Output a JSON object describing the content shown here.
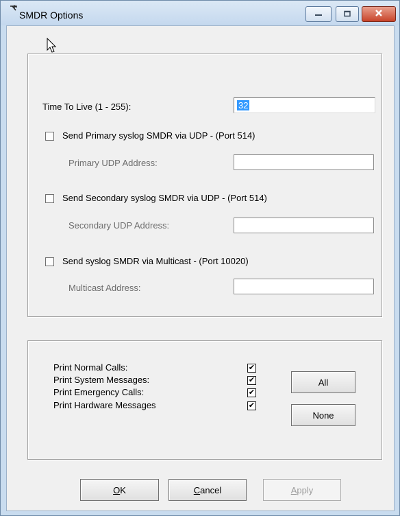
{
  "window": {
    "title": "SMDR Options",
    "icon": "smdr-app-icon",
    "controls": [
      "minimize-icon",
      "maximize-icon",
      "close-icon"
    ]
  },
  "syslog": {
    "ttl_label": "Time To Live (1 - 255):",
    "ttl_value": "32",
    "primary_checkbox": "Send Primary syslog SMDR via UDP - (Port 514)",
    "primary_address_label": "Primary UDP Address:",
    "primary_address_value": "",
    "secondary_checkbox": "Send Secondary syslog SMDR via UDP - (Port 514)",
    "secondary_address_label": "Secondary UDP Address:",
    "secondary_address_value": "",
    "multicast_checkbox": "Send syslog SMDR via Multicast - (Port 10020)",
    "multicast_address_label": "Multicast Address:",
    "multicast_address_value": ""
  },
  "print_options": {
    "items": [
      {
        "label": "Print Normal Calls:",
        "checked": true
      },
      {
        "label": "Print System Messages:",
        "checked": true
      },
      {
        "label": "Print Emergency Calls:",
        "checked": true
      },
      {
        "label": "Print Hardware Messages",
        "checked": true
      }
    ],
    "all_label": "All",
    "none_label": "None"
  },
  "footer": {
    "ok_mnemonic": "O",
    "ok_rest": "K",
    "cancel_mnemonic": "C",
    "cancel_rest": "ancel",
    "apply_mnemonic": "A",
    "apply_rest": "pply"
  }
}
